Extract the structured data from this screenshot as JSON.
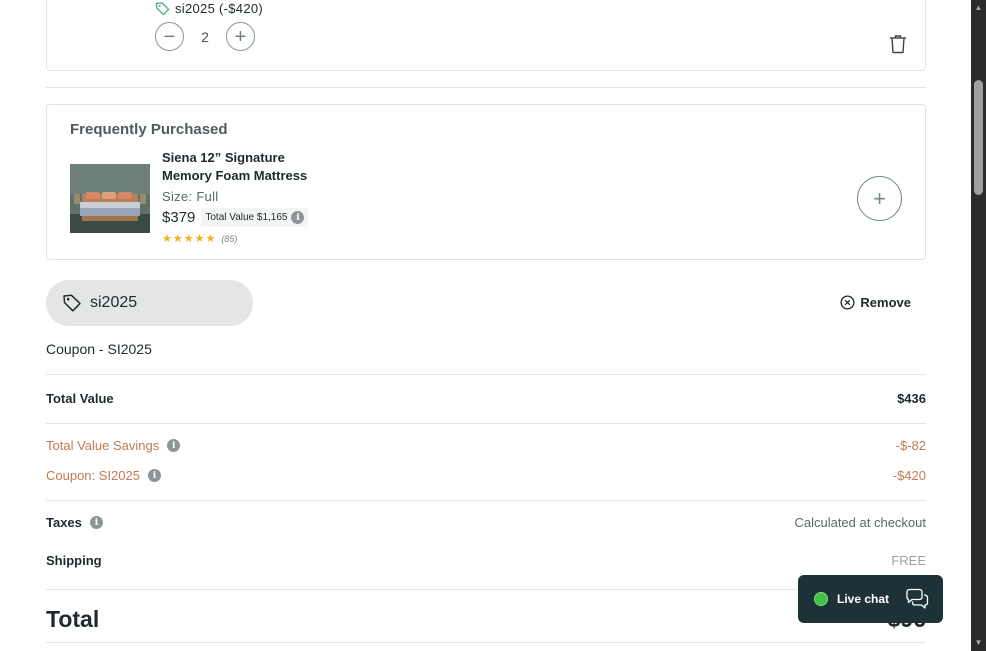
{
  "cart_item": {
    "coupon_applied": "si2025 (-$420)",
    "quantity": "2",
    "minus_symbol": "−",
    "plus_symbol": "+"
  },
  "frequently_purchased": {
    "title": "Frequently Purchased",
    "product": {
      "name": "Siena 12” Signature Memory Foam Mattress",
      "size": "Size: Full",
      "price": "$379",
      "total_value": "Total Value $1,165",
      "stars": "★★★★★",
      "rating_count": "(85)"
    },
    "add_symbol": "+"
  },
  "coupon": {
    "code": "si2025",
    "remove_label": "Remove",
    "label": "Coupon - SI2025"
  },
  "summary": {
    "total_value_label": "Total Value",
    "total_value": "$436",
    "savings_label": "Total Value Savings",
    "savings_value": "-$-82",
    "coupon_label": "Coupon: SI2025",
    "coupon_value": "-$420",
    "taxes_label": "Taxes",
    "taxes_value": "Calculated at checkout",
    "shipping_label": "Shipping",
    "shipping_value": "FREE",
    "total_label": "Total",
    "total_value_final": "$96"
  },
  "live_chat": {
    "label": "Live chat"
  },
  "colors": {
    "accent_dark": "#1c3237",
    "savings_orange": "#c07a55",
    "live_green": "#3fc246",
    "star_gold": "#f2b01e"
  },
  "icons": [
    "tag-icon",
    "trash-icon",
    "info-icon",
    "close-circle-icon",
    "chat-bubbles-icon",
    "plus-icon",
    "minus-icon"
  ]
}
